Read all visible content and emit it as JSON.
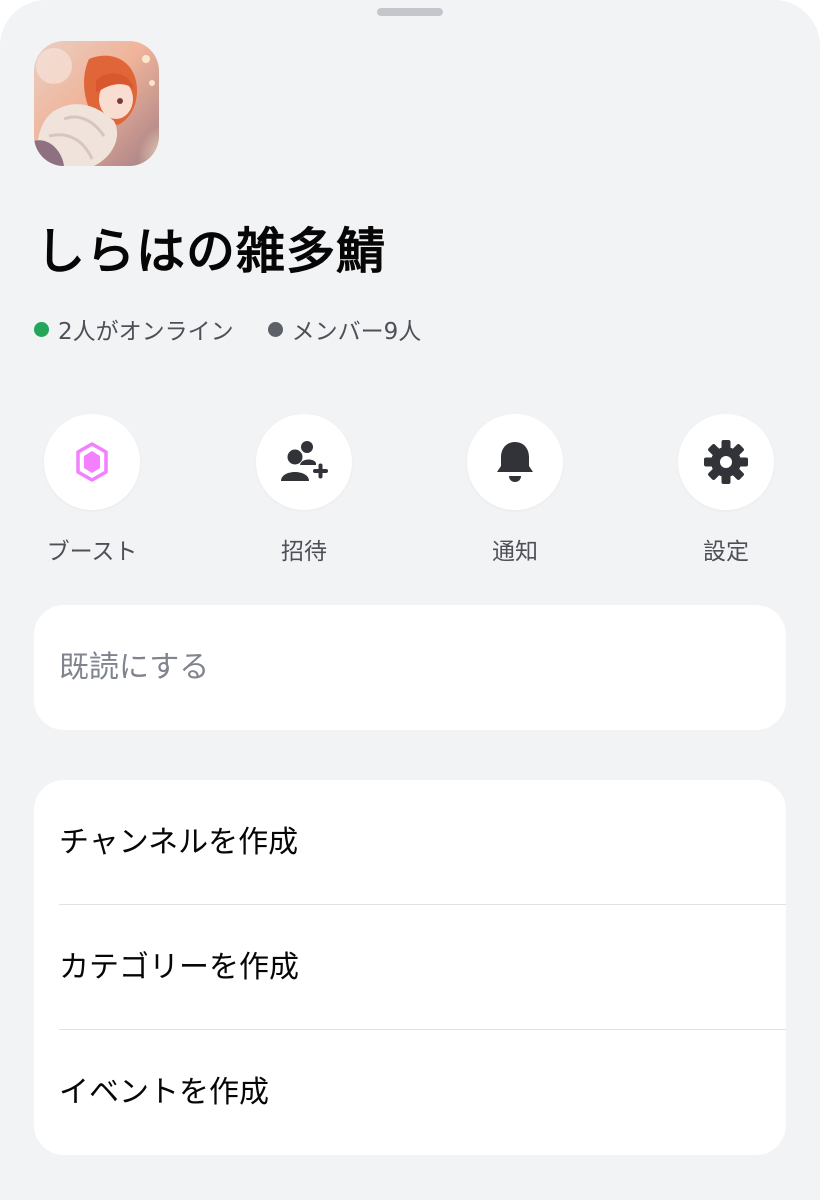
{
  "server": {
    "name": "しらはの雑多鯖",
    "icon": "server-avatar-anime-illustration",
    "online_text": "2人がオンライン",
    "members_text": "メンバー9人"
  },
  "colors": {
    "online_dot": "#23a55a",
    "members_dot": "#5d6068",
    "boost_accent": "#f47fff",
    "icon_dark": "#313338",
    "sheet_background": "#f2f3f5",
    "card_background": "#ffffff"
  },
  "actions": [
    {
      "label": "ブースト",
      "icon": "boost-gem-icon"
    },
    {
      "label": "招待",
      "icon": "invite-user-plus-icon"
    },
    {
      "label": "通知",
      "icon": "bell-icon"
    },
    {
      "label": "設定",
      "icon": "gear-icon"
    }
  ],
  "mark_as_read": {
    "label": "既読にする"
  },
  "create_menu": [
    {
      "label": "チャンネルを作成"
    },
    {
      "label": "カテゴリーを作成"
    },
    {
      "label": "イベントを作成"
    }
  ]
}
